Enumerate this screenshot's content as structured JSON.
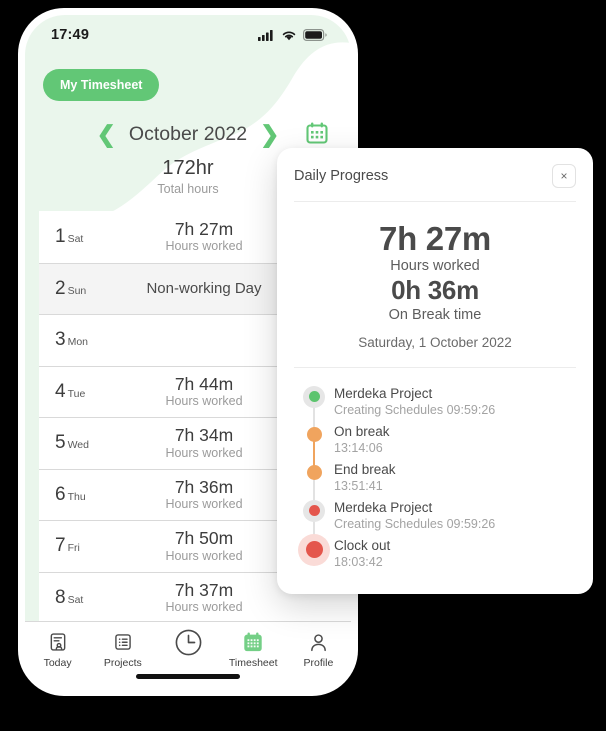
{
  "phone": {
    "statusbar": {
      "time": "17:49",
      "icons": [
        "signal-icon",
        "wifi-icon",
        "battery-icon"
      ]
    },
    "pill_label": "My Timesheet",
    "month_nav": {
      "prev_icon": "chevron-left-icon",
      "next_icon": "chevron-right-icon",
      "month": "October 2022",
      "calendar_icon": "calendar-icon"
    },
    "total": {
      "value": "172hr",
      "label": "Total hours"
    },
    "days": [
      {
        "num": "1",
        "dow": "Sat",
        "hours": "7h 27m",
        "sub": "Hours worked",
        "note": "",
        "nonworking": false
      },
      {
        "num": "2",
        "dow": "Sun",
        "hours": "",
        "sub": "",
        "note": "Non-working Day",
        "nonworking": true
      },
      {
        "num": "3",
        "dow": "Mon",
        "hours": "",
        "sub": "",
        "note": "",
        "nonworking": false
      },
      {
        "num": "4",
        "dow": "Tue",
        "hours": "7h 44m",
        "sub": "Hours worked",
        "note": "",
        "nonworking": false
      },
      {
        "num": "5",
        "dow": "Wed",
        "hours": "7h 34m",
        "sub": "Hours worked",
        "note": "",
        "nonworking": false
      },
      {
        "num": "6",
        "dow": "Thu",
        "hours": "7h 36m",
        "sub": "Hours worked",
        "note": "",
        "nonworking": false
      },
      {
        "num": "7",
        "dow": "Fri",
        "hours": "7h 50m",
        "sub": "Hours worked",
        "note": "",
        "nonworking": false
      },
      {
        "num": "8",
        "dow": "Sat",
        "hours": "7h 37m",
        "sub": "Hours worked",
        "note": "",
        "nonworking": false
      }
    ],
    "bottom_nav": {
      "active": "Timesheet",
      "items": [
        {
          "label": "Today",
          "icon": "today-report-icon"
        },
        {
          "label": "Projects",
          "icon": "list-icon"
        },
        {
          "label": "",
          "icon": "clock-icon"
        },
        {
          "label": "Timesheet",
          "icon": "calendar-icon"
        },
        {
          "label": "Profile",
          "icon": "person-icon"
        }
      ]
    }
  },
  "card": {
    "title": "Daily Progress",
    "close_icon": "close-icon",
    "close_label": "×",
    "worked_value": "7h 27m",
    "worked_label": "Hours worked",
    "break_value": "0h 36m",
    "break_label": "On Break time",
    "date": "Saturday, 1 October 2022",
    "timeline": [
      {
        "title": "Merdeka Project",
        "sub": "Creating Schedules 09:59:26",
        "dot": "green",
        "halo": "gray",
        "size": "small"
      },
      {
        "title": "On break",
        "sub": "13:14:06",
        "dot": "orange",
        "halo": "none",
        "size": "small"
      },
      {
        "title": "End break",
        "sub": "13:51:41",
        "dot": "orange",
        "halo": "none",
        "size": "small"
      },
      {
        "title": "Merdeka Project",
        "sub": "Creating Schedules 09:59:26",
        "dot": "red",
        "halo": "gray",
        "size": "small"
      },
      {
        "title": "Clock out",
        "sub": "18:03:42",
        "dot": "red",
        "halo": "red",
        "size": "big"
      }
    ]
  },
  "colors": {
    "green": "#62c776",
    "green_soft": "#eaf6ec",
    "orange": "#f0a45e",
    "red": "#e4564c",
    "text_dark": "#3d3d3d",
    "text_muted": "#9b9b9b"
  }
}
